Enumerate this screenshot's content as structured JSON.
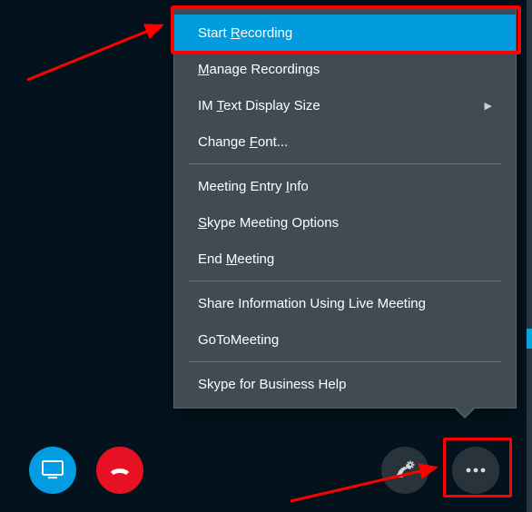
{
  "menu": {
    "items": [
      {
        "pre": "Start ",
        "u": "R",
        "post": "ecording",
        "highlight": true
      },
      {
        "pre": "",
        "u": "M",
        "post": "anage Recordings"
      },
      {
        "pre": "IM ",
        "u": "T",
        "post": "ext Display Size",
        "submenu": true
      },
      {
        "pre": "Change ",
        "u": "F",
        "post": "ont..."
      },
      {
        "sep": true
      },
      {
        "pre": "Meeting Entry ",
        "u": "I",
        "post": "nfo"
      },
      {
        "pre": "",
        "u": "S",
        "post": "kype Meeting Options"
      },
      {
        "pre": "End ",
        "u": "M",
        "post": "eeting"
      },
      {
        "sep": true
      },
      {
        "pre": "Share Information Using Live Meetin",
        "u": "g",
        "post": ""
      },
      {
        "pre": "GoToMeetin",
        "u": "g",
        "post": ""
      },
      {
        "sep": true
      },
      {
        "pre": "Skype for Business Help",
        "u": "",
        "post": ""
      }
    ]
  },
  "controls": {
    "present": "Present",
    "hangup": "Hang up",
    "devices": "Audio device settings",
    "more": "More options"
  },
  "colors": {
    "accent": "#019cde",
    "menu_bg": "#414b53",
    "hangup": "#e81123"
  }
}
